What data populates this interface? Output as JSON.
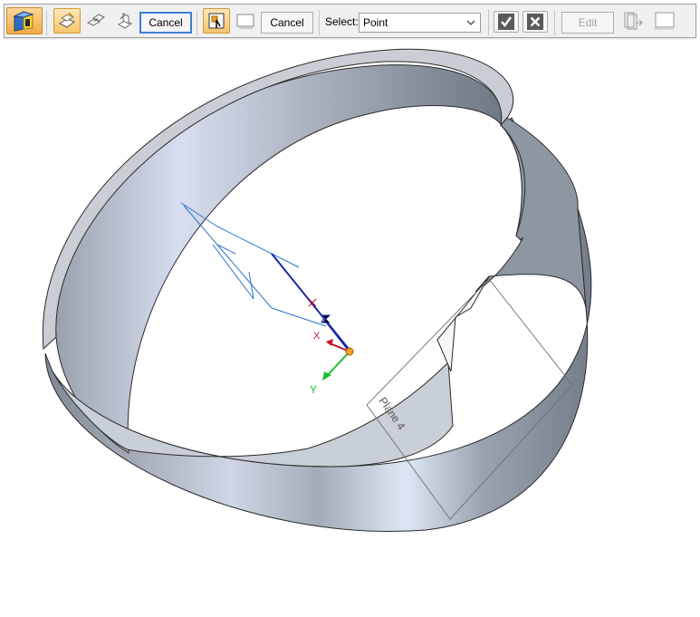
{
  "toolbar": {
    "cancel_1": "Cancel",
    "cancel_2": "Cancel",
    "select_label": "Select:",
    "select_value": "Point",
    "edit_label": "Edit"
  },
  "icons": {
    "part_feature": "part-feature-icon",
    "coincident_plane": "coincident-plane-icon",
    "parallel_plane": "parallel-plane-icon",
    "angled_plane": "angled-plane-icon",
    "plane_step": "plane-step-icon",
    "extent_step": "extent-step-icon",
    "accept": "checkmark-icon",
    "deselect": "close-icon",
    "preview": "preview-icon",
    "finish": "finish-icon"
  },
  "viewport": {
    "plane_label": "Plane 4",
    "axis_x": "X",
    "axis_y": "Y",
    "axis_z": "Z"
  },
  "colors": {
    "toolbar_bg": "#f0f0f0",
    "active_orange": "#f6c56a",
    "part_gray": "#a7adb7",
    "axis_x": "#c0142c",
    "axis_y": "#1cbd30",
    "axis_z": "#1628a8",
    "sketch_blue": "#2a73c8"
  }
}
